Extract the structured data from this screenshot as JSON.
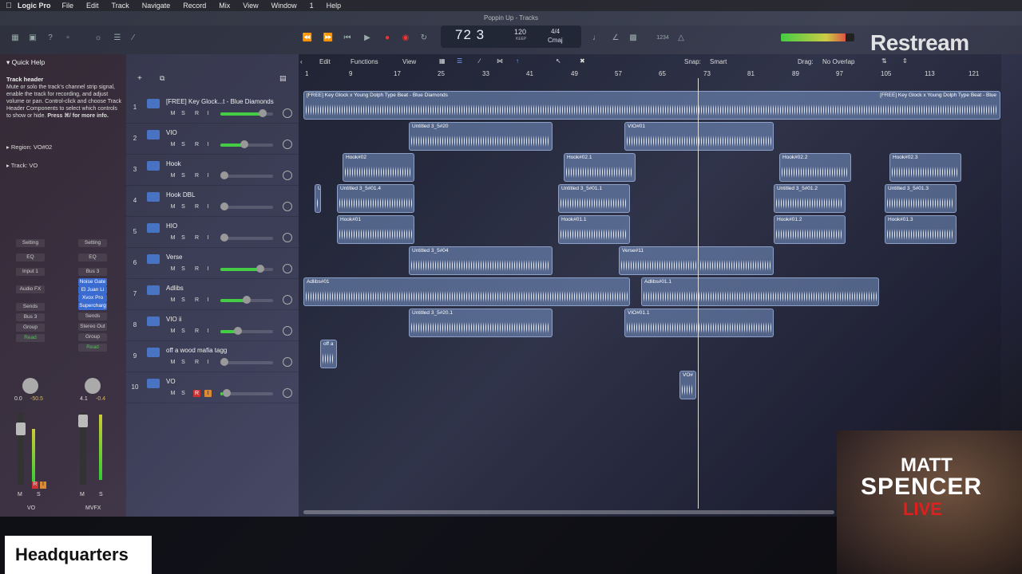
{
  "menubar": {
    "app": "Logic Pro",
    "items": [
      "File",
      "Edit",
      "Track",
      "Navigate",
      "Record",
      "Mix",
      "View",
      "Window",
      "1",
      "Help"
    ]
  },
  "window": {
    "title": "Poppin Up - Tracks"
  },
  "lcd": {
    "bar": "72",
    "beat": "3",
    "tempo": "120",
    "tempo_mode": "KEEP",
    "signature": "4/4",
    "key": "Cmaj"
  },
  "transport": {
    "count_in": "1234"
  },
  "overlay": {
    "restream": "Restream",
    "headquarters": "Headquarters",
    "matt": "MATT",
    "spencer": "SPENCER",
    "live": "LIVE"
  },
  "quickhelp": {
    "title": "Quick Help",
    "heading": "Track header",
    "body": "Mute or solo the track's channel strip signal, enable the track for recording, and adjust volume or pan. Control-click and choose Track Header Components to select which controls to show or hide.",
    "more": "Press ⌘/ for more info.",
    "region_label": "Region:",
    "region_value": "VO#02",
    "track_label": "Track:",
    "track_value": "VO"
  },
  "strips": [
    {
      "setting": "Setting",
      "eq": "EQ",
      "input": "Input 1",
      "audiofx": "Audio FX",
      "sends": "Sends",
      "output": "Bus 3",
      "group": "Group",
      "auto": "Read",
      "pan": "0.0",
      "gain": "-50.5",
      "name": "VO"
    },
    {
      "setting": "Setting",
      "eq": "EQ",
      "input": "Bus 3",
      "plugins": [
        "Noise Gate",
        "El Juan Li",
        "Xvox Pro",
        "Supercharg"
      ],
      "sends": "Sends",
      "output": "Stereo Out",
      "group": "Group",
      "auto": "Read",
      "pan": "4.1",
      "gain": "-0.4",
      "name": "MVFX"
    }
  ],
  "arrange_menu": {
    "edit": "Edit",
    "functions": "Functions",
    "view": "View",
    "snap_label": "Snap:",
    "snap_value": "Smart",
    "drag_label": "Drag:",
    "drag_value": "No Overlap"
  },
  "ruler": [
    "1",
    "9",
    "17",
    "25",
    "33",
    "41",
    "49",
    "57",
    "65",
    "73",
    "81",
    "89",
    "97",
    "105",
    "113",
    "121"
  ],
  "tracks": [
    {
      "num": "1",
      "name": "[FREE] Key Glock...t - Blue Diamonds",
      "level": 0.85
    },
    {
      "num": "2",
      "name": "VIO",
      "level": 0.45
    },
    {
      "num": "3",
      "name": "Hook",
      "level": 0.0
    },
    {
      "num": "4",
      "name": "Hook DBL",
      "level": 0.0
    },
    {
      "num": "5",
      "name": "HIO",
      "level": 0.0
    },
    {
      "num": "6",
      "name": "Verse",
      "level": 0.8
    },
    {
      "num": "7",
      "name": "Adlibs",
      "level": 0.5
    },
    {
      "num": "8",
      "name": "VIO ii",
      "level": 0.3
    },
    {
      "num": "9",
      "name": "off a wood mafia tagg",
      "level": 0.0
    },
    {
      "num": "10",
      "name": "VO",
      "level": 0.05
    }
  ],
  "regions": [
    {
      "row": 0,
      "start": 1,
      "end": 127,
      "name": "[FREE] Key Glock x Young Dolph Type Beat - Blue Diamonds",
      "name2": "[FREE] Key Glock x Young Dolph Type Beat - Blue"
    },
    {
      "row": 1,
      "start": 20,
      "end": 46,
      "name": "Untitled 3_5#20"
    },
    {
      "row": 1,
      "start": 59,
      "end": 86,
      "name": "VIO#01"
    },
    {
      "row": 2,
      "start": 8,
      "end": 21,
      "name": "Hook#02"
    },
    {
      "row": 2,
      "start": 48,
      "end": 61,
      "name": "Hook#02.1"
    },
    {
      "row": 2,
      "start": 87,
      "end": 100,
      "name": "Hook#02.2"
    },
    {
      "row": 2,
      "start": 107,
      "end": 120,
      "name": "Hook#02.3"
    },
    {
      "row": 3,
      "start": 3,
      "end": 4,
      "name": "Un"
    },
    {
      "row": 3,
      "start": 7,
      "end": 21,
      "name": "Untitled 3_5#01.4"
    },
    {
      "row": 3,
      "start": 47,
      "end": 60,
      "name": "Untitled 3_5#01.1"
    },
    {
      "row": 3,
      "start": 86,
      "end": 99,
      "name": "Untitled 3_5#01.2"
    },
    {
      "row": 3,
      "start": 106,
      "end": 119,
      "name": "Untitled 3_5#01.3"
    },
    {
      "row": 4,
      "start": 7,
      "end": 21,
      "name": "Hook#01"
    },
    {
      "row": 4,
      "start": 47,
      "end": 60,
      "name": "Hook#01.1"
    },
    {
      "row": 4,
      "start": 86,
      "end": 99,
      "name": "Hook#01.2"
    },
    {
      "row": 4,
      "start": 106,
      "end": 119,
      "name": "Hook#01.3"
    },
    {
      "row": 5,
      "start": 20,
      "end": 46,
      "name": "Untitled 3_5#04"
    },
    {
      "row": 5,
      "start": 58,
      "end": 86,
      "name": "Verse#11"
    },
    {
      "row": 6,
      "start": 1,
      "end": 60,
      "name": "Adlibs#01"
    },
    {
      "row": 6,
      "start": 62,
      "end": 105,
      "name": "Adlibs#01.1"
    },
    {
      "row": 7,
      "start": 20,
      "end": 46,
      "name": "Untitled 3_5#20.1"
    },
    {
      "row": 7,
      "start": 59,
      "end": 86,
      "name": "VIO#01.1"
    },
    {
      "row": 8,
      "start": 4,
      "end": 7,
      "name": "off a"
    },
    {
      "row": 9,
      "start": 69,
      "end": 72,
      "name": "VO#"
    }
  ],
  "colors": {
    "region": "#7a96c8",
    "rec": "#cc3333",
    "accent": "#4a7ed6"
  }
}
